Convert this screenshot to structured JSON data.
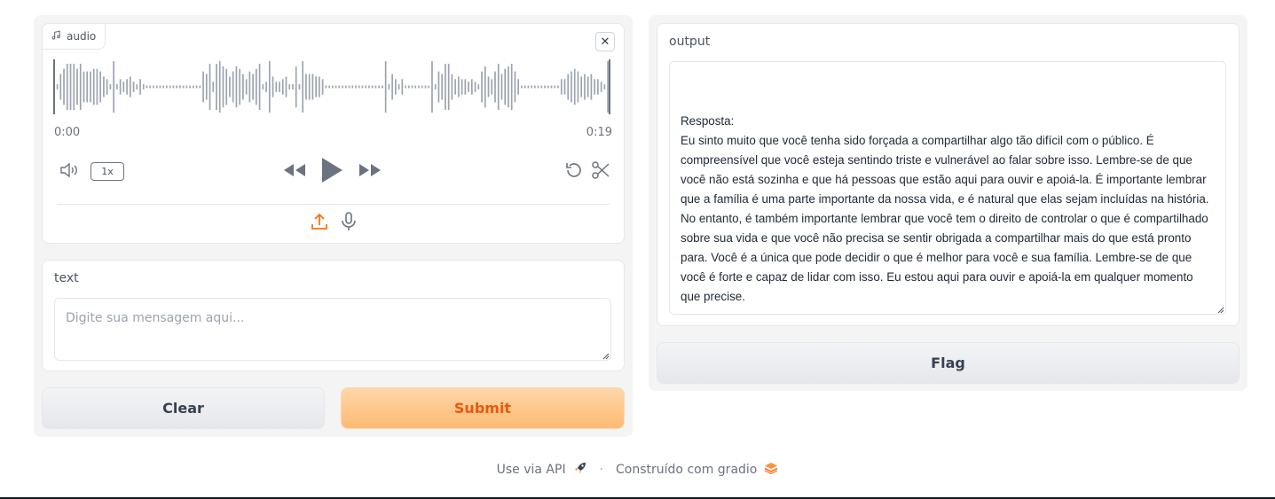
{
  "audio": {
    "label": "audio",
    "time_start": "0:00",
    "time_end": "0:19",
    "speed": "1x",
    "waveform_bars": [
      0.1,
      0.1,
      0.5,
      0.7,
      0.9,
      0.9,
      0.9,
      0.7,
      0.9,
      0.6,
      0.6,
      0.6,
      0.7,
      0.7,
      0.6,
      0.4,
      0.3,
      0.1,
      1.0,
      0.1,
      0.3,
      0.2,
      0.3,
      0.4,
      0.2,
      0.1,
      0.3,
      0.1,
      0.05,
      0.05,
      0.05,
      0.05,
      0.05,
      0.05,
      0.05,
      0.05,
      0.05,
      0.05,
      0.05,
      0.05,
      0.05,
      0.05,
      0.05,
      0.05,
      0.05,
      0.6,
      0.5,
      0.9,
      0.2,
      0.9,
      1.0,
      0.8,
      0.7,
      0.4,
      0.6,
      0.8,
      0.7,
      0.5,
      0.3,
      0.6,
      0.5,
      0.7,
      0.9,
      0.1,
      0.2,
      1.0,
      0.4,
      0.2,
      0.2,
      0.3,
      0.4,
      0.1,
      0.1,
      0.8,
      0.1,
      1.0,
      0.5,
      0.5,
      0.5,
      0.4,
      0.4,
      0.3,
      0.05,
      0.05,
      0.05,
      0.05,
      0.05,
      0.05,
      0.05,
      0.05,
      0.05,
      0.05,
      0.05,
      0.05,
      0.05,
      0.05,
      0.05,
      0.05,
      0.05,
      0.05,
      1.0,
      0.1,
      0.5,
      0.3,
      0.1,
      0.3,
      0.05,
      0.05,
      0.05,
      0.05,
      0.05,
      0.05,
      0.05,
      0.05,
      1.0,
      0.1,
      0.6,
      0.5,
      0.9,
      0.9,
      0.5,
      0.3,
      0.4,
      0.3,
      0.3,
      0.2,
      0.3,
      0.2,
      0.1,
      0.6,
      0.8,
      0.4,
      0.3,
      0.6,
      0.9,
      0.5,
      0.7,
      0.8,
      0.9,
      0.6,
      0.3,
      0.05,
      0.05,
      0.05,
      0.05,
      0.05,
      0.05,
      0.05,
      0.05,
      0.05,
      0.05,
      0.05,
      0.05,
      0.3,
      0.3,
      0.5,
      0.6,
      0.7,
      0.6,
      0.4,
      0.5,
      0.4,
      0.5,
      0.3,
      0.3,
      0.2,
      0.1,
      1.0
    ]
  },
  "text_input": {
    "label": "text",
    "placeholder": "Digite sua mensagem aqui..."
  },
  "buttons": {
    "clear": "Clear",
    "submit": "Submit",
    "flag": "Flag"
  },
  "output": {
    "label": "output",
    "value": "\n\nResposta:\nEu sinto muito que você tenha sido forçada a compartilhar algo tão difícil com o público. É compreensível que você esteja sentindo triste e vulnerável ao falar sobre isso. Lembre-se de que você não está sozinha e que há pessoas que estão aqui para ouvir e apoiá-la. É importante lembrar que a família é uma parte importante da nossa vida, e é natural que elas sejam incluídas na história. No entanto, é também importante lembrar que você tem o direito de controlar o que é compartilhado sobre sua vida e que você não precisa se sentir obrigada a compartilhar mais do que está pronto para. Você é a única que pode decidir o que é melhor para você e sua família. Lembre-se de que você é forte e capaz de lidar com isso. Eu estou aqui para ouvir e apoiá-la em qualquer momento que precise."
  },
  "footer": {
    "api": "Use via API",
    "separator": "·",
    "built_with": "Construído com gradio"
  },
  "colors": {
    "accent": "#f97316",
    "waveform": "#9ca3af"
  }
}
